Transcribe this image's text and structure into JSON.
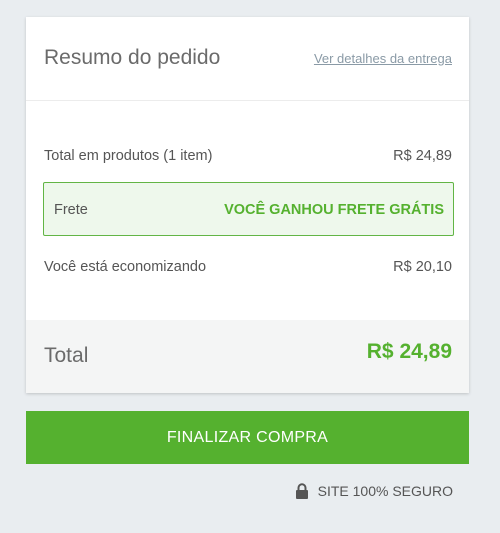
{
  "summary": {
    "title": "Resumo do pedido",
    "details_link": "Ver detalhes da entrega",
    "products_label": "Total em produtos (1 item)",
    "products_value": "R$ 24,89",
    "shipping_label": "Frete",
    "shipping_value": "VOCÊ GANHOU FRETE GRÁTIS",
    "savings_label": "Você está economizando",
    "savings_value": "R$ 20,10",
    "total_label": "Total",
    "total_value": "R$ 24,89"
  },
  "checkout": {
    "button_label": "FINALIZAR COMPRA",
    "secure_label": "SITE 100% SEGURO",
    "secure_icon": "lock-icon"
  },
  "colors": {
    "accent": "#55b12f",
    "background": "#e9edf0",
    "shipping_bg": "#eef8ec"
  }
}
